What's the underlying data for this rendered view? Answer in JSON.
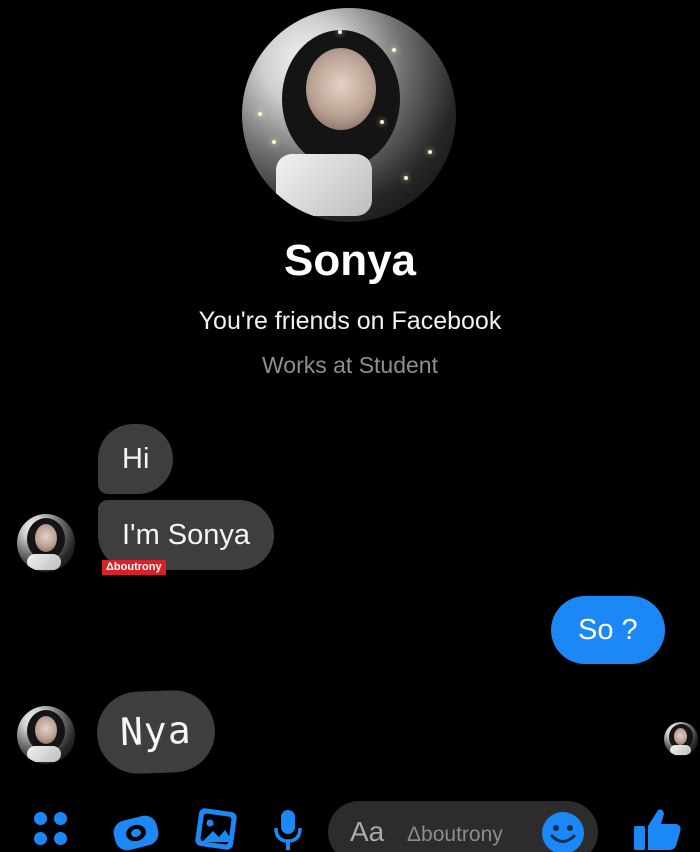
{
  "profile": {
    "name": "Sonya",
    "friendship": "You're friends on Facebook",
    "work": "Works at Student"
  },
  "messages": [
    {
      "from": "contact",
      "text": "Hi"
    },
    {
      "from": "contact",
      "text": "I'm Sonya"
    },
    {
      "from": "me",
      "text": "So ?"
    },
    {
      "from": "contact",
      "text": "Nya"
    }
  ],
  "watermarks": {
    "tag": "Δboutrony",
    "input": "Δboutrony"
  },
  "composer": {
    "placeholder": "Aa"
  },
  "icons": {
    "menu": "four-dots-icon",
    "camera": "camera-icon",
    "gallery": "gallery-icon",
    "mic": "microphone-icon",
    "emoji": "smiley-icon",
    "like": "thumbs-up-icon"
  },
  "colors": {
    "background": "#000000",
    "incoming_bubble": "#3e3e3e",
    "outgoing_bubble": "#1b88f5",
    "accent": "#1b88f5",
    "watermark_tag": "#d82128"
  }
}
